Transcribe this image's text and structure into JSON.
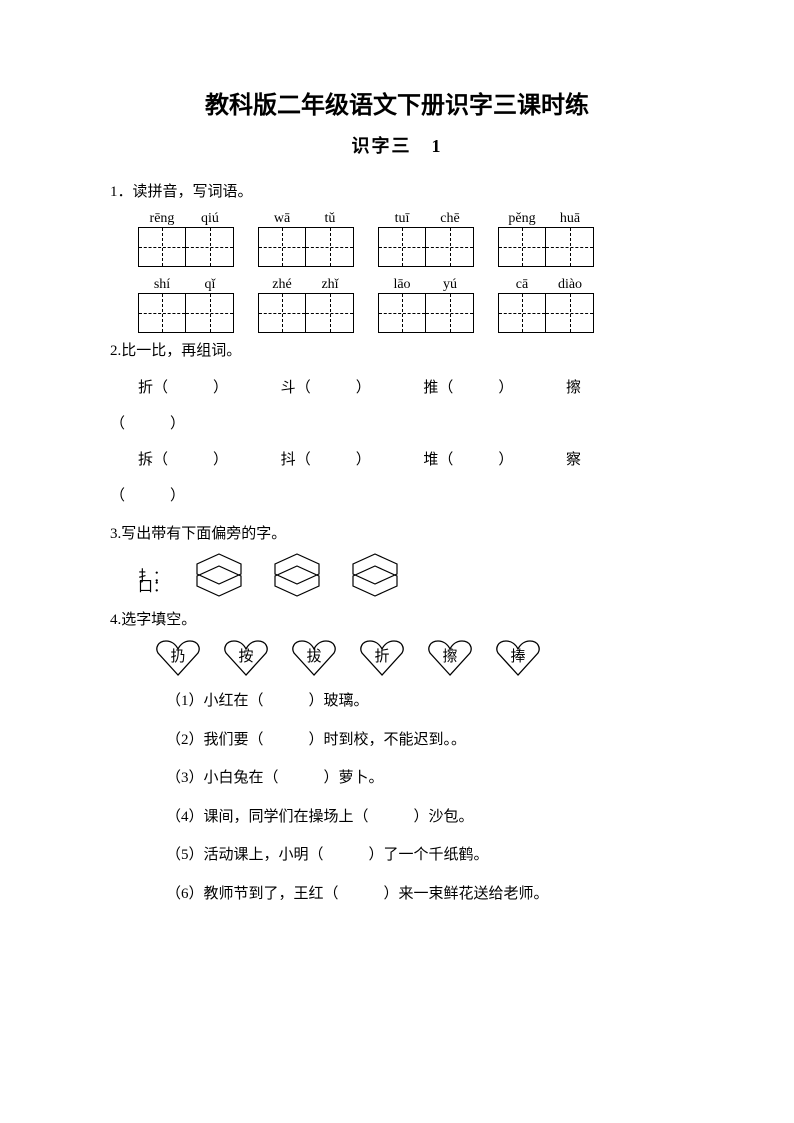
{
  "title": "教科版二年级语文下册识字三课时练",
  "subtitle": "识字三　1",
  "q1": {
    "label": "1．读拼音，写词语。",
    "row1": [
      [
        "rēng",
        "qiú"
      ],
      [
        "wā",
        "tǔ"
      ],
      [
        "tuī",
        "chē"
      ],
      [
        "pěng",
        "huā"
      ]
    ],
    "row2": [
      [
        "shí",
        "qǐ"
      ],
      [
        "zhé",
        "zhǐ"
      ],
      [
        "lāo",
        "yú"
      ],
      [
        "cā",
        "diào"
      ]
    ]
  },
  "q2": {
    "label": "2.比一比，再组词。",
    "row1": [
      "折",
      "斗",
      "推",
      "擦"
    ],
    "row2": [
      "拆",
      "抖",
      "堆",
      "察"
    ]
  },
  "q3": {
    "label": "3.写出带有下面偏旁的字。",
    "radicals": [
      "扌：",
      "口："
    ]
  },
  "q4": {
    "label": "4.选字填空。",
    "choices": [
      "扔",
      "按",
      "拔",
      "折",
      "擦",
      "捧"
    ],
    "items": [
      "（1）小红在（　　　）玻璃。",
      "（2）我们要（　　　）时到校，不能迟到。。",
      "（3）小白兔在（　　　）萝卜。",
      "（4）课间，同学们在操场上（　　　）沙包。",
      "（5）活动课上，小明（　　　）了一个千纸鹤。",
      "（6）教师节到了，王红（　　　）来一束鲜花送给老师。"
    ]
  }
}
